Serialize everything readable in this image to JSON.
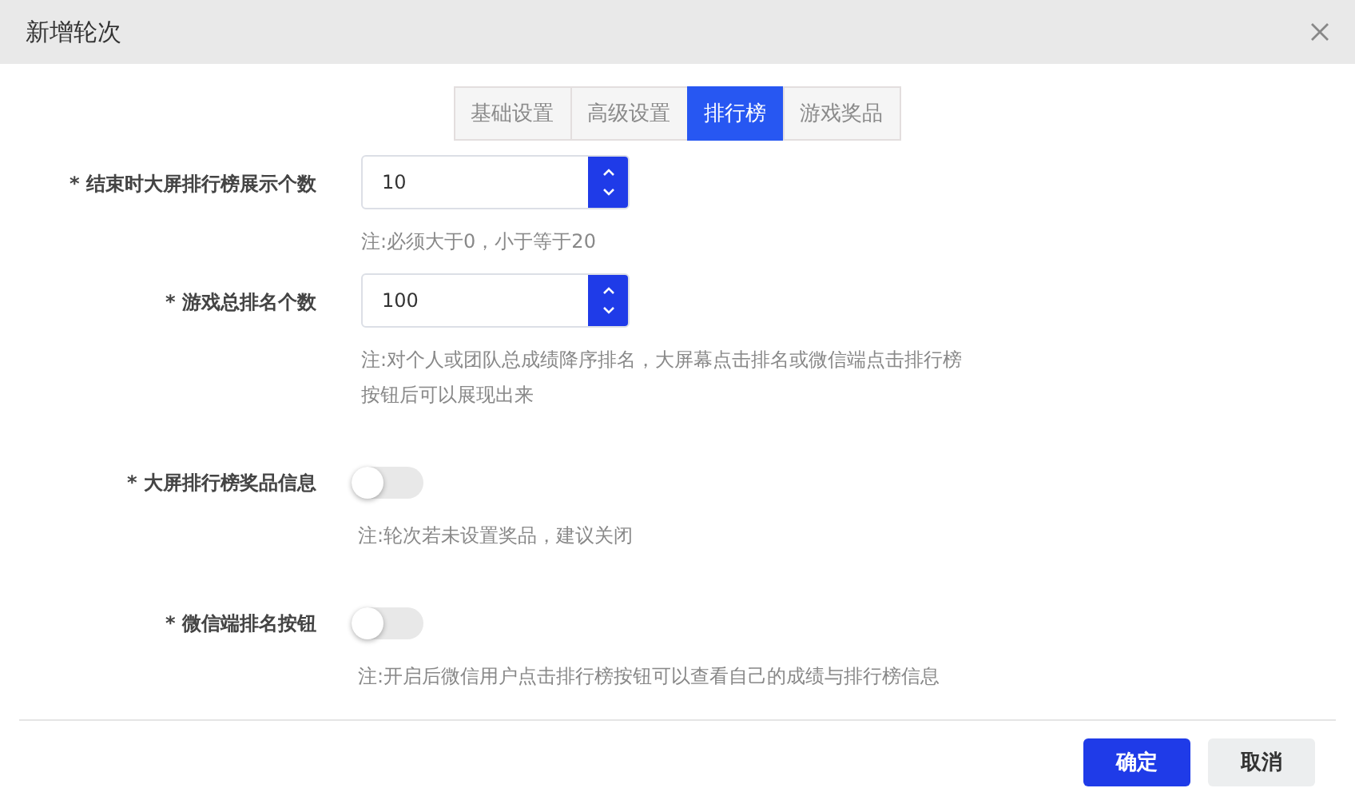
{
  "dialog": {
    "title": "新增轮次"
  },
  "tabs": [
    {
      "label": "基础设置",
      "selected": false
    },
    {
      "label": "高级设置",
      "selected": false
    },
    {
      "label": "排行榜",
      "selected": true
    },
    {
      "label": "游戏奖品",
      "selected": false
    }
  ],
  "fields": [
    {
      "kind": "number",
      "label": "* 结束时大屏排行榜展示个数",
      "value": "10",
      "hints": [
        "注:必须大于0，小于等于20"
      ]
    },
    {
      "kind": "number",
      "label": "* 游戏总排名个数",
      "value": "100",
      "hints": [
        "注:对个人或团队总成绩降序排名，大屏幕点击排名或微信端点击排行榜",
        "按钮后可以展现出来"
      ]
    },
    {
      "kind": "switch",
      "label": "* 大屏排行榜奖品信息",
      "on": false,
      "hints": [
        "注:轮次若未设置奖品，建议关闭"
      ]
    },
    {
      "kind": "switch",
      "label": "* 微信端排名按钮",
      "on": false,
      "hints": [
        "注:开启后微信用户点击排行榜按钮可以查看自己的成绩与排行榜信息"
      ]
    }
  ],
  "buttons": [
    {
      "kind": "primary",
      "label": "确定"
    },
    {
      "kind": "secondary",
      "label": "取消"
    }
  ]
}
